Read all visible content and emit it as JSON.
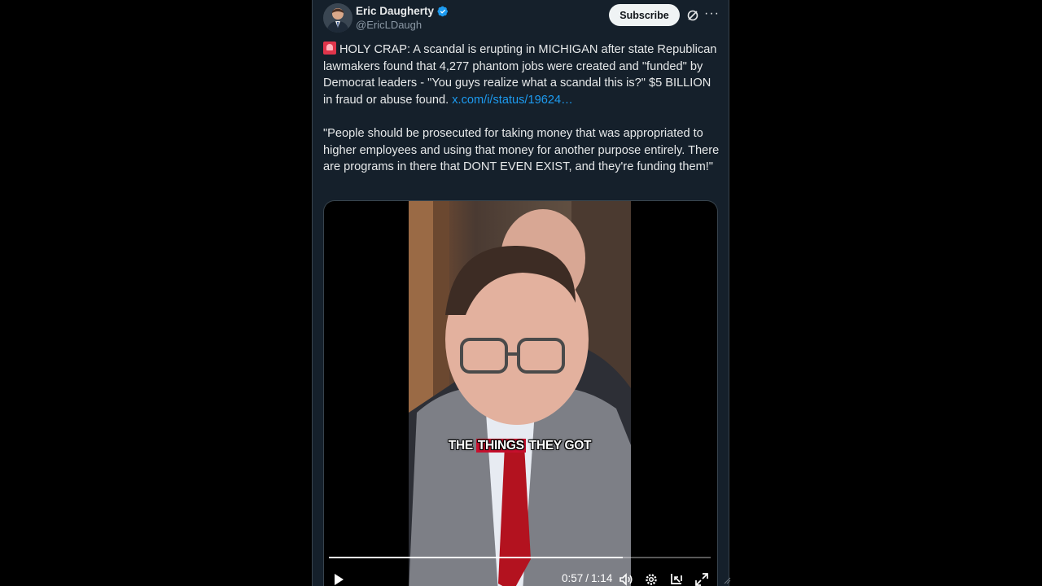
{
  "author": {
    "display_name": "Eric Daugherty",
    "handle": "@EricLDaugh",
    "verified_icon": "verified-badge-icon"
  },
  "actions": {
    "subscribe_label": "Subscribe",
    "grok_icon": "grok-icon",
    "more_icon": "more-icon"
  },
  "tweet": {
    "emoji": "rotating-light-emoji",
    "paragraph1": "HOLY CRAP: A scandal is erupting in MICHIGAN after state Republican lawmakers found that 4,277 phantom jobs were created and \"funded\" by Democrat leaders - \"You guys realize what a scandal this is?\" $5 BILLION in fraud or abuse found.",
    "link_text": "x.com/i/status/19624…",
    "paragraph2": "\"People should be prosecuted for taking money that was appropriated to higher employees and using that money for another purpose entirely. There are programs in there that DONT EVEN EXIST, and they're funding them!\""
  },
  "video": {
    "caption_pre": "THE ",
    "caption_highlight": "THINGS",
    "caption_post": " THEY GOT",
    "progress_fraction": 0.77,
    "current_time": "0:57",
    "separator": "/",
    "duration": "1:14"
  },
  "colors": {
    "background": "#15202b",
    "accent_link": "#1d9bf0",
    "verified": "#1d9bf0",
    "caption_highlight": "#c8102e"
  }
}
